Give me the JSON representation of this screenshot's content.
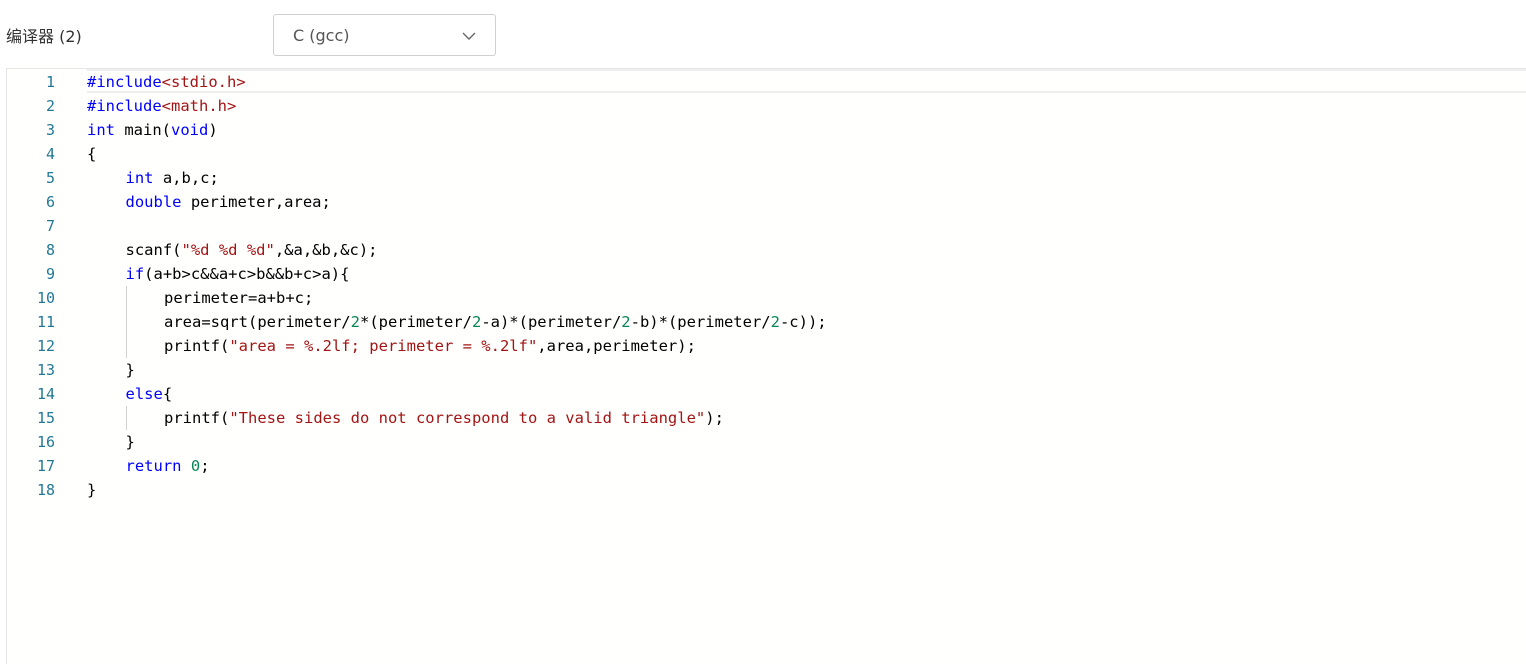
{
  "toolbar": {
    "compiler_label": "编译器 (2)",
    "compiler_select": {
      "value": "C (gcc)",
      "icon": "chevron-down-icon"
    }
  },
  "colors": {
    "line_number": "#237893",
    "keyword": "#0000ff",
    "string": "#a31515",
    "number": "#098658",
    "text": "#000000"
  },
  "editor": {
    "lines": [
      {
        "number": "1",
        "indent": 0,
        "tokens": [
          {
            "t": "kw",
            "v": "#include"
          },
          {
            "t": "str",
            "v": "<stdio.h>"
          }
        ]
      },
      {
        "number": "2",
        "indent": 0,
        "tokens": [
          {
            "t": "kw",
            "v": "#include"
          },
          {
            "t": "str",
            "v": "<math.h>"
          }
        ]
      },
      {
        "number": "3",
        "indent": 0,
        "tokens": [
          {
            "t": "kw",
            "v": "int"
          },
          {
            "t": "txt",
            "v": " main("
          },
          {
            "t": "kw",
            "v": "void"
          },
          {
            "t": "txt",
            "v": ")"
          }
        ]
      },
      {
        "number": "4",
        "indent": 0,
        "tokens": [
          {
            "t": "txt",
            "v": "{"
          }
        ]
      },
      {
        "number": "5",
        "indent": 1,
        "tokens": [
          {
            "t": "kw",
            "v": "int"
          },
          {
            "t": "txt",
            "v": " a,b,c;"
          }
        ]
      },
      {
        "number": "6",
        "indent": 1,
        "tokens": [
          {
            "t": "kw",
            "v": "double"
          },
          {
            "t": "txt",
            "v": " perimeter,area;"
          }
        ]
      },
      {
        "number": "7",
        "indent": 0,
        "tokens": []
      },
      {
        "number": "8",
        "indent": 1,
        "tokens": [
          {
            "t": "txt",
            "v": "scanf("
          },
          {
            "t": "str",
            "v": "\"%d %d %d\""
          },
          {
            "t": "txt",
            "v": ",&a,&b,&c);"
          }
        ]
      },
      {
        "number": "9",
        "indent": 1,
        "tokens": [
          {
            "t": "kw",
            "v": "if"
          },
          {
            "t": "txt",
            "v": "(a+b>c&&a+c>b&&b+c>a){"
          }
        ]
      },
      {
        "number": "10",
        "indent": 2,
        "tokens": [
          {
            "t": "txt",
            "v": "perimeter=a+b+c;"
          }
        ]
      },
      {
        "number": "11",
        "indent": 2,
        "tokens": [
          {
            "t": "txt",
            "v": "area=sqrt(perimeter/"
          },
          {
            "t": "num",
            "v": "2"
          },
          {
            "t": "txt",
            "v": "*(perimeter/"
          },
          {
            "t": "num",
            "v": "2"
          },
          {
            "t": "txt",
            "v": "-a)*(perimeter/"
          },
          {
            "t": "num",
            "v": "2"
          },
          {
            "t": "txt",
            "v": "-b)*(perimeter/"
          },
          {
            "t": "num",
            "v": "2"
          },
          {
            "t": "txt",
            "v": "-c));"
          }
        ]
      },
      {
        "number": "12",
        "indent": 2,
        "tokens": [
          {
            "t": "txt",
            "v": "printf("
          },
          {
            "t": "str",
            "v": "\"area = %.2lf; perimeter = %.2lf\""
          },
          {
            "t": "txt",
            "v": ",area,perimeter);"
          }
        ]
      },
      {
        "number": "13",
        "indent": 1,
        "tokens": [
          {
            "t": "txt",
            "v": "}"
          }
        ]
      },
      {
        "number": "14",
        "indent": 1,
        "tokens": [
          {
            "t": "kw",
            "v": "else"
          },
          {
            "t": "txt",
            "v": "{"
          }
        ]
      },
      {
        "number": "15",
        "indent": 2,
        "tokens": [
          {
            "t": "txt",
            "v": "printf("
          },
          {
            "t": "str",
            "v": "\"These sides do not correspond to a valid triangle\""
          },
          {
            "t": "txt",
            "v": ");"
          }
        ]
      },
      {
        "number": "16",
        "indent": 1,
        "tokens": [
          {
            "t": "txt",
            "v": "}"
          }
        ]
      },
      {
        "number": "17",
        "indent": 1,
        "tokens": [
          {
            "t": "kw",
            "v": "return"
          },
          {
            "t": "txt",
            "v": " "
          },
          {
            "t": "num",
            "v": "0"
          },
          {
            "t": "txt",
            "v": ";"
          }
        ]
      },
      {
        "number": "18",
        "indent": 0,
        "tokens": [
          {
            "t": "txt",
            "v": "}"
          }
        ]
      }
    ]
  }
}
